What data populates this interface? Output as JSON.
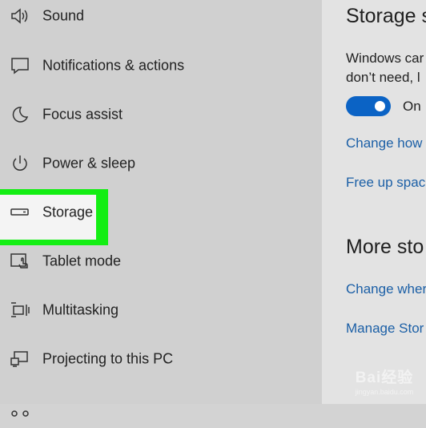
{
  "sidebar": {
    "items": [
      {
        "label": "Sound",
        "icon": "speaker-icon"
      },
      {
        "label": "Notifications & actions",
        "icon": "notification-icon"
      },
      {
        "label": "Focus assist",
        "icon": "moon-icon"
      },
      {
        "label": "Power & sleep",
        "icon": "power-icon"
      },
      {
        "label": "Storage",
        "icon": "storage-drive-icon",
        "selected": true
      },
      {
        "label": "Tablet mode",
        "icon": "tablet-mode-icon"
      },
      {
        "label": "Multitasking",
        "icon": "multitasking-icon"
      },
      {
        "label": "Projecting to this PC",
        "icon": "projecting-icon"
      }
    ]
  },
  "main": {
    "storage_title": "Storage s",
    "storage_desc_line1": "Windows car",
    "storage_desc_line2": "don’t need, l",
    "toggle": {
      "state": "On",
      "on": true
    },
    "link_change_how": "Change how",
    "link_free_up": "Free up spac",
    "more_title": "More sto",
    "link_change_where": "Change wher",
    "link_manage": "Manage Stor"
  },
  "watermark": {
    "main": "Bai经验",
    "sub": "jingyan.baidu.com"
  },
  "colors": {
    "accent": "#0b63c5",
    "link": "#1b5fa6",
    "highlight": "#13ee13"
  }
}
